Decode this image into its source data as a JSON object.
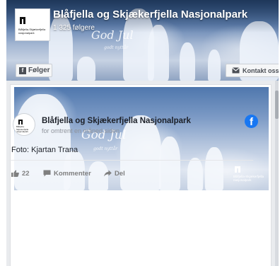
{
  "page": {
    "name": "Blåfjella og Skjækerfjella Nasjonalpark",
    "followers": "1 325 følgere",
    "logo_text": "Blåfjella-Skjækerfjella nasjonalpark",
    "follow_label": "Følger",
    "contact_label": "Kontakt oss"
  },
  "cover": {
    "script_title": "God Jul",
    "script_sub": "godt nyttår"
  },
  "post": {
    "image_title": "God Jul",
    "image_sub": "godt nyttår",
    "image_logo_text": "Blåfjella-Skjækerfjella nasjonalpark",
    "author": "Blåfjella og Skjækerfjella Nasjonalpark",
    "time": "for omtrent en måned siden",
    "text": "Foto: Kjartan Trana",
    "likes": "22",
    "comment_label": "Kommenter",
    "share_label": "Del"
  },
  "icons": {
    "facebook": "facebook-logo-icon",
    "like": "thumbs-up-icon",
    "comment": "comment-bubble-icon",
    "share": "share-arrow-icon",
    "mail": "envelope-icon"
  },
  "colors": {
    "facebook_blue": "#1877f2",
    "action_grey": "#7f7f7f",
    "text_dark": "#1d2129",
    "meta_grey": "#90949c"
  }
}
